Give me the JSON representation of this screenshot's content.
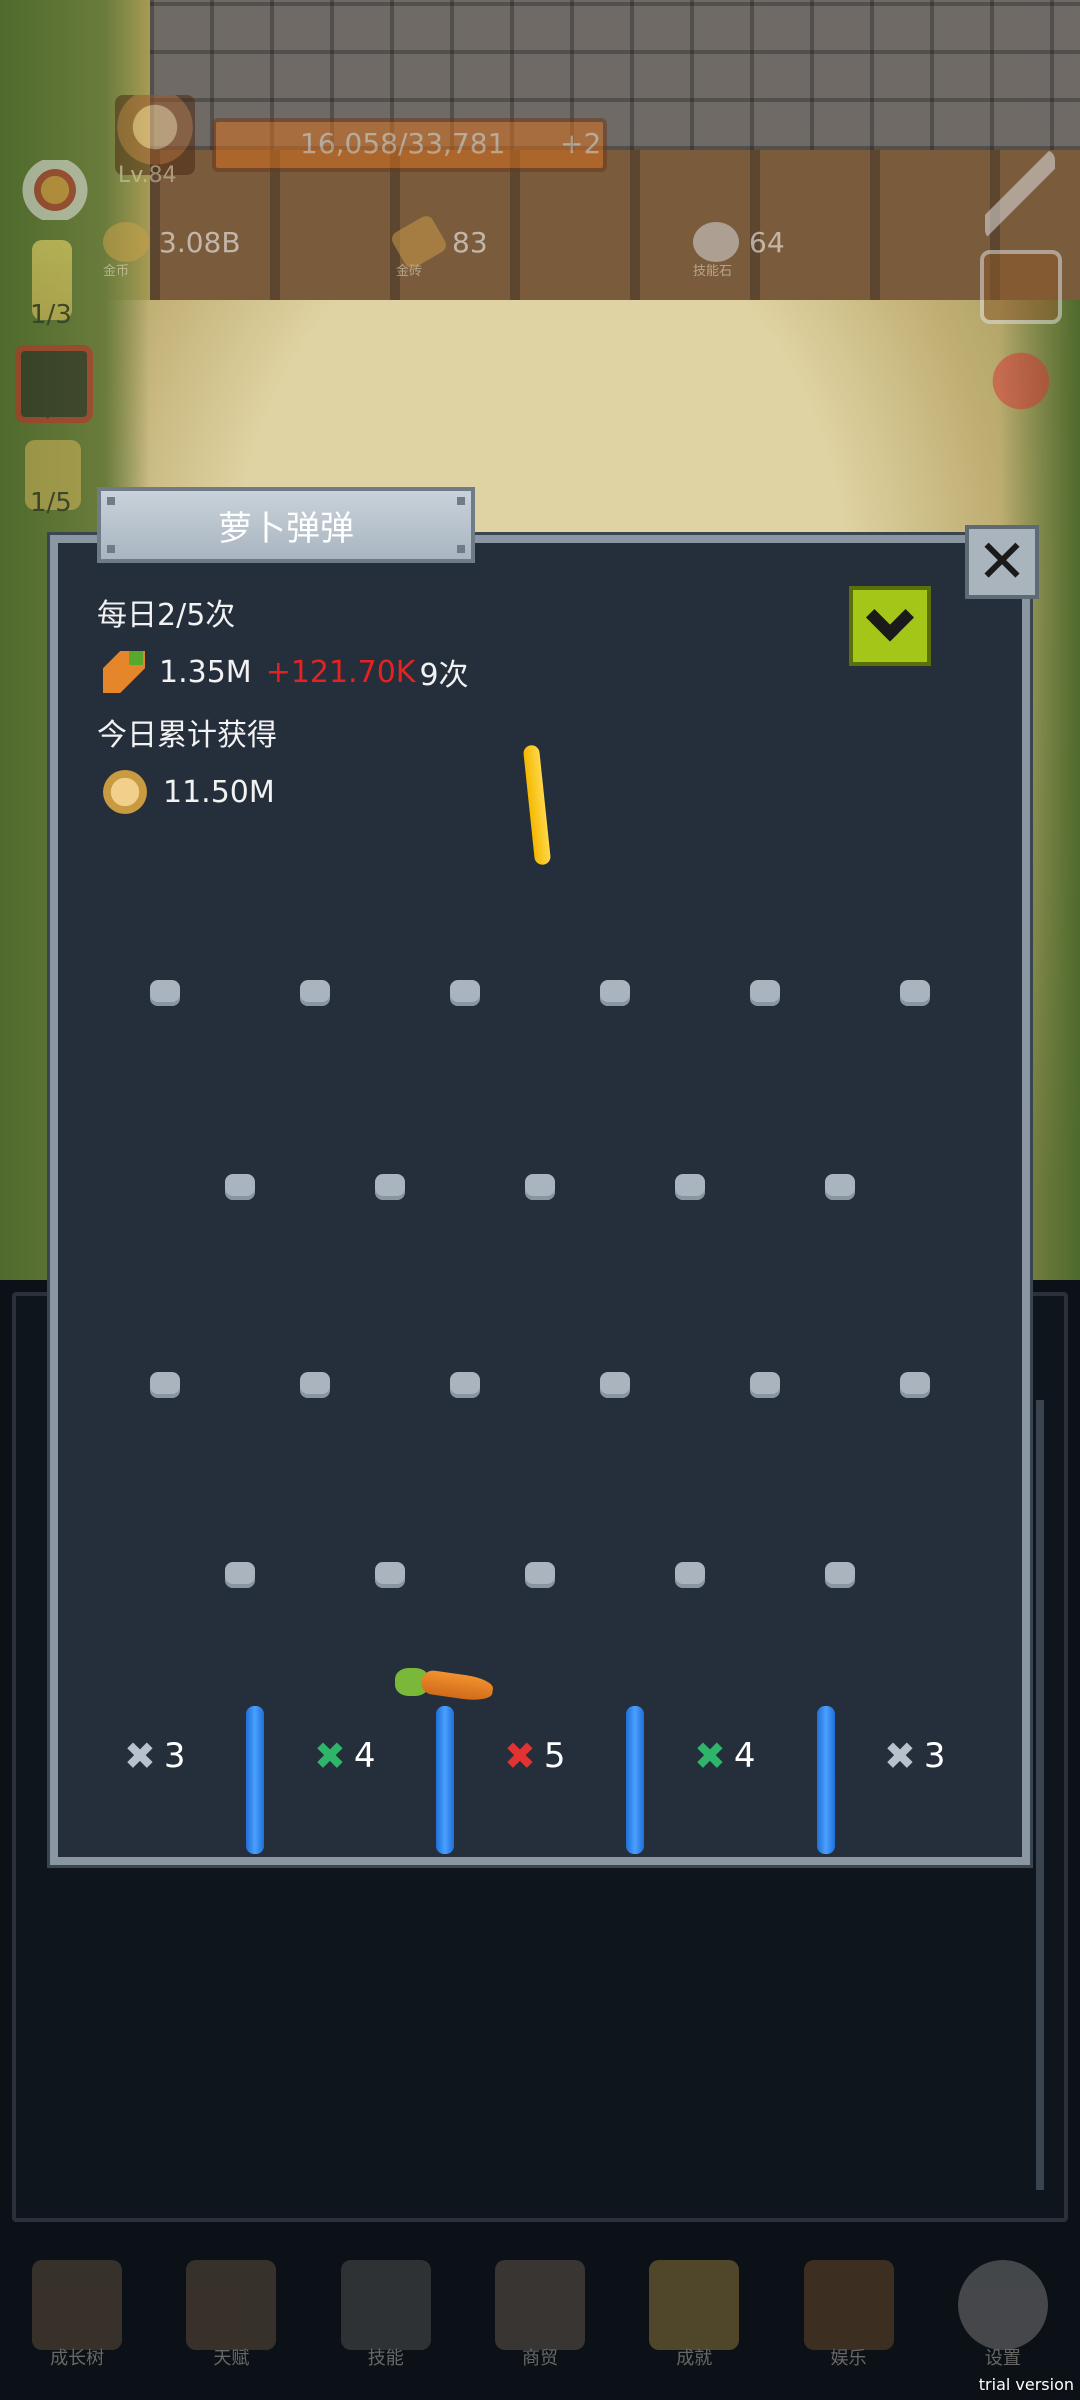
{
  "hud": {
    "level": "Lv.84",
    "xp": "16,058/33,781",
    "xp_bonus": "+2",
    "resources": [
      {
        "value": "3.08B",
        "caption": "金币",
        "icon": "gold-coin-icon"
      },
      {
        "value": "83",
        "caption": "金砖",
        "icon": "gold-bar-icon"
      },
      {
        "value": "64",
        "caption": "技能石",
        "icon": "skill-stone-icon"
      }
    ],
    "side_counts": {
      "candle": "1/3",
      "book": "1/5",
      "cup": "1/5"
    }
  },
  "dialog": {
    "title": "萝卜弹弹",
    "daily": "每日2/5次",
    "carrot_value": "1.35M",
    "carrot_gain": "+121.70K",
    "carrot_times": "9次",
    "today_label": "今日累计获得",
    "today_value": "11.50M",
    "close_icon": "close-icon",
    "collapse_icon": "chevron-down-icon"
  },
  "board": {
    "rows": [
      6,
      5,
      6,
      5
    ],
    "buckets": [
      {
        "multiplier": "3",
        "color": "#b8c2cc"
      },
      {
        "multiplier": "4",
        "color": "#2fb56a"
      },
      {
        "multiplier": "5",
        "color": "#e23232"
      },
      {
        "multiplier": "4",
        "color": "#2fb56a"
      },
      {
        "multiplier": "3",
        "color": "#b8c2cc"
      }
    ]
  },
  "nav": [
    {
      "label": "成长树",
      "icon": "book-icon"
    },
    {
      "label": "天赋",
      "icon": "scroll-icon"
    },
    {
      "label": "技能",
      "icon": "sword-icon"
    },
    {
      "label": "商贸",
      "icon": "map-icon"
    },
    {
      "label": "成就",
      "icon": "key-icon"
    },
    {
      "label": "娱乐",
      "icon": "horn-icon"
    },
    {
      "label": "设置",
      "icon": "gear-icon"
    }
  ],
  "watermark": "trial version"
}
